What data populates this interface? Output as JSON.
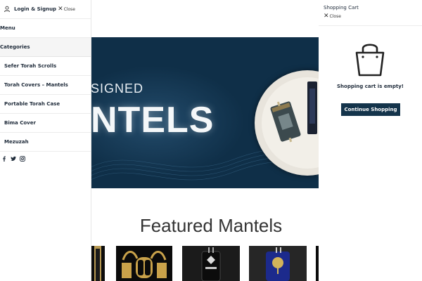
{
  "menu_panel": {
    "login_label": "Login & Signup",
    "close_label": "Close",
    "menu_label": "Menu",
    "categories_label": "Categories",
    "categories": [
      {
        "label": "Sefer Torah Scrolls"
      },
      {
        "label": "Torah Covers – Mantels"
      },
      {
        "label": "Portable Torah Case"
      },
      {
        "label": "Bima Cover"
      },
      {
        "label": "Mezuzah"
      }
    ],
    "social_icons": [
      "facebook-icon",
      "twitter-icon",
      "instagram-icon"
    ]
  },
  "banner": {
    "subtitle": "SIGNED",
    "title": "NTELS"
  },
  "cart": {
    "title": "Shopping Cart",
    "close_label": "Close",
    "empty_message": "Shopping cart is empty!",
    "continue_label": "Continue Shopping"
  },
  "featured": {
    "title": "Featured Mantels"
  },
  "colors": {
    "brand_navy": "#14344b",
    "banner_bg": "#0f2f48",
    "text_dark": "#1f2b3a"
  }
}
